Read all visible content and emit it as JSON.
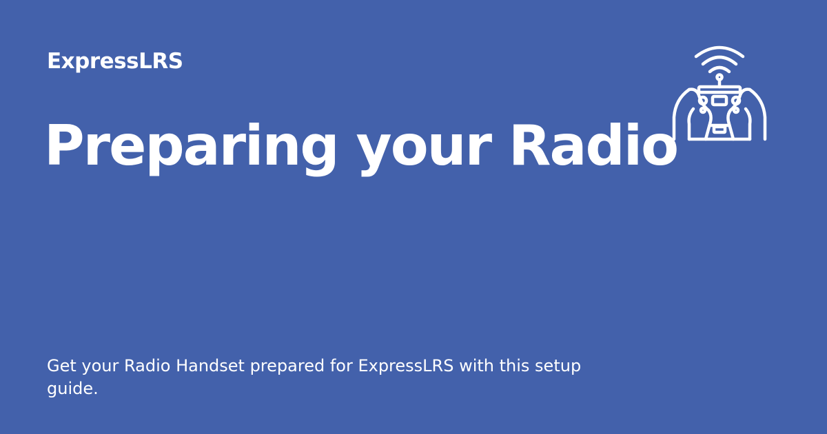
{
  "site": {
    "name": "ExpressLRS"
  },
  "page": {
    "title": "Preparing your Radio",
    "description": "Get your Radio Handset prepared for ExpressLRS with this setup guide."
  },
  "logo": {
    "icon": "radio-controller-icon",
    "color": "#FFFFFF"
  },
  "colors": {
    "background": "#4361AB",
    "text": "#FFFFFF"
  }
}
